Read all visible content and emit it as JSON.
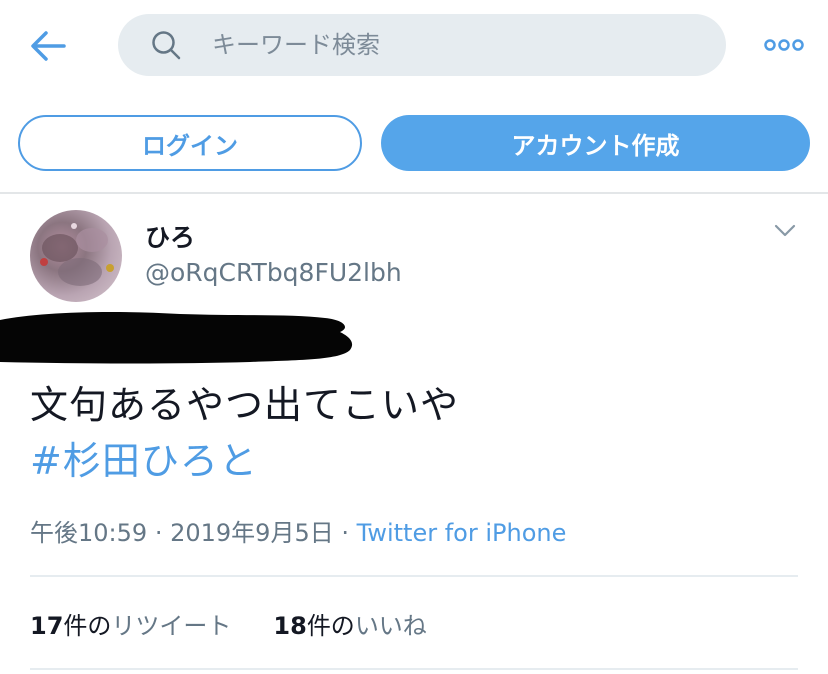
{
  "search": {
    "placeholder": "キーワード検索"
  },
  "icons": {
    "back": "arrow-left-icon",
    "search": "search-icon",
    "more": "more-dots-icon",
    "caret": "chevron-down-icon"
  },
  "auth": {
    "login_label": "ログイン",
    "signup_label": "アカウント作成"
  },
  "tweet": {
    "display_name": "ひろ",
    "handle": "@oRqCRTbq8FU2lbh",
    "text": "文句あるやつ出てこいや",
    "hashtag": "#杉田ひろと",
    "time": "午後10:59",
    "sep": "·",
    "date": "2019年9月5日",
    "source": "Twitter for iPhone",
    "retweets": {
      "count": "17",
      "count_suffix": "件の",
      "label": "リツイート"
    },
    "likes": {
      "count": "18",
      "count_suffix": "件の",
      "label": "いいね"
    }
  },
  "colors": {
    "accent": "#4f9ce4",
    "accent_fill": "#55a5ea",
    "muted": "#657786",
    "search_bg": "#e6ecf0"
  }
}
